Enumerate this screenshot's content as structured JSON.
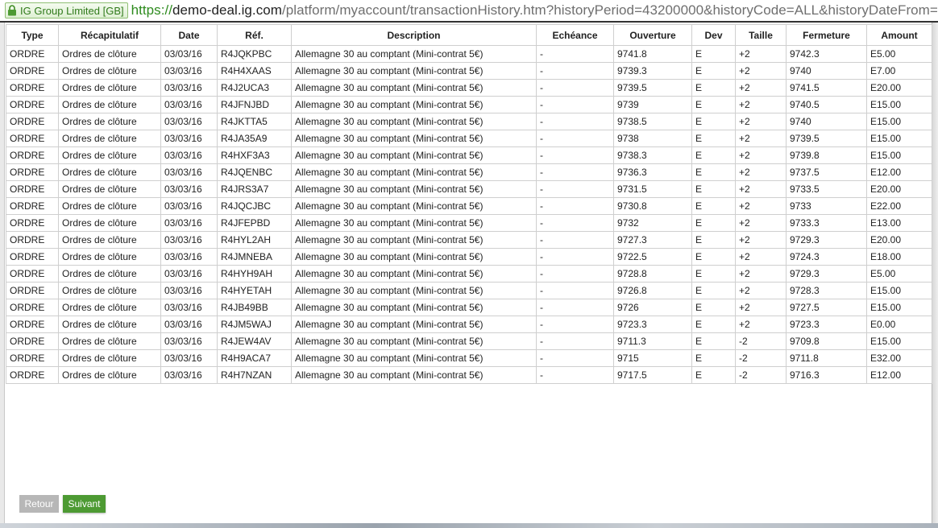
{
  "browser": {
    "cert_label": "IG Group Limited [GB]",
    "url_scheme": "https://",
    "url_host": "demo-deal.ig.com",
    "url_rest": "/platform/myaccount/transactionHistory.htm?historyPeriod=43200000&historyCode=ALL&historyDateFrom=TODA"
  },
  "table": {
    "headers": [
      "Type",
      "Récapitulatif",
      "Date",
      "Réf.",
      "Description",
      "Echéance",
      "Ouverture",
      "Dev",
      "Taille",
      "Fermeture",
      "Amount"
    ],
    "rows": [
      [
        "ORDRE",
        "Ordres de clôture",
        "03/03/16",
        "R4JQKPBC",
        "Allemagne 30 au comptant (Mini-contrat 5€)",
        "-",
        "9741.8",
        "E",
        "+2",
        "9742.3",
        "E5.00"
      ],
      [
        "ORDRE",
        "Ordres de clôture",
        "03/03/16",
        "R4H4XAAS",
        "Allemagne 30 au comptant (Mini-contrat 5€)",
        "-",
        "9739.3",
        "E",
        "+2",
        "9740",
        "E7.00"
      ],
      [
        "ORDRE",
        "Ordres de clôture",
        "03/03/16",
        "R4J2UCA3",
        "Allemagne 30 au comptant (Mini-contrat 5€)",
        "-",
        "9739.5",
        "E",
        "+2",
        "9741.5",
        "E20.00"
      ],
      [
        "ORDRE",
        "Ordres de clôture",
        "03/03/16",
        "R4JFNJBD",
        "Allemagne 30 au comptant (Mini-contrat 5€)",
        "-",
        "9739",
        "E",
        "+2",
        "9740.5",
        "E15.00"
      ],
      [
        "ORDRE",
        "Ordres de clôture",
        "03/03/16",
        "R4JKTTA5",
        "Allemagne 30 au comptant (Mini-contrat 5€)",
        "-",
        "9738.5",
        "E",
        "+2",
        "9740",
        "E15.00"
      ],
      [
        "ORDRE",
        "Ordres de clôture",
        "03/03/16",
        "R4JA35A9",
        "Allemagne 30 au comptant (Mini-contrat 5€)",
        "-",
        "9738",
        "E",
        "+2",
        "9739.5",
        "E15.00"
      ],
      [
        "ORDRE",
        "Ordres de clôture",
        "03/03/16",
        "R4HXF3A3",
        "Allemagne 30 au comptant (Mini-contrat 5€)",
        "-",
        "9738.3",
        "E",
        "+2",
        "9739.8",
        "E15.00"
      ],
      [
        "ORDRE",
        "Ordres de clôture",
        "03/03/16",
        "R4JQENBC",
        "Allemagne 30 au comptant (Mini-contrat 5€)",
        "-",
        "9736.3",
        "E",
        "+2",
        "9737.5",
        "E12.00"
      ],
      [
        "ORDRE",
        "Ordres de clôture",
        "03/03/16",
        "R4JRS3A7",
        "Allemagne 30 au comptant (Mini-contrat 5€)",
        "-",
        "9731.5",
        "E",
        "+2",
        "9733.5",
        "E20.00"
      ],
      [
        "ORDRE",
        "Ordres de clôture",
        "03/03/16",
        "R4JQCJBC",
        "Allemagne 30 au comptant (Mini-contrat 5€)",
        "-",
        "9730.8",
        "E",
        "+2",
        "9733",
        "E22.00"
      ],
      [
        "ORDRE",
        "Ordres de clôture",
        "03/03/16",
        "R4JFEPBD",
        "Allemagne 30 au comptant (Mini-contrat 5€)",
        "-",
        "9732",
        "E",
        "+2",
        "9733.3",
        "E13.00"
      ],
      [
        "ORDRE",
        "Ordres de clôture",
        "03/03/16",
        "R4HYL2AH",
        "Allemagne 30 au comptant (Mini-contrat 5€)",
        "-",
        "9727.3",
        "E",
        "+2",
        "9729.3",
        "E20.00"
      ],
      [
        "ORDRE",
        "Ordres de clôture",
        "03/03/16",
        "R4JMNEBA",
        "Allemagne 30 au comptant (Mini-contrat 5€)",
        "-",
        "9722.5",
        "E",
        "+2",
        "9724.3",
        "E18.00"
      ],
      [
        "ORDRE",
        "Ordres de clôture",
        "03/03/16",
        "R4HYH9AH",
        "Allemagne 30 au comptant (Mini-contrat 5€)",
        "-",
        "9728.8",
        "E",
        "+2",
        "9729.3",
        "E5.00"
      ],
      [
        "ORDRE",
        "Ordres de clôture",
        "03/03/16",
        "R4HYETAH",
        "Allemagne 30 au comptant (Mini-contrat 5€)",
        "-",
        "9726.8",
        "E",
        "+2",
        "9728.3",
        "E15.00"
      ],
      [
        "ORDRE",
        "Ordres de clôture",
        "03/03/16",
        "R4JB49BB",
        "Allemagne 30 au comptant (Mini-contrat 5€)",
        "-",
        "9726",
        "E",
        "+2",
        "9727.5",
        "E15.00"
      ],
      [
        "ORDRE",
        "Ordres de clôture",
        "03/03/16",
        "R4JM5WAJ",
        "Allemagne 30 au comptant (Mini-contrat 5€)",
        "-",
        "9723.3",
        "E",
        "+2",
        "9723.3",
        "E0.00"
      ],
      [
        "ORDRE",
        "Ordres de clôture",
        "03/03/16",
        "R4JEW4AV",
        "Allemagne 30 au comptant (Mini-contrat 5€)",
        "-",
        "9711.3",
        "E",
        "-2",
        "9709.8",
        "E15.00"
      ],
      [
        "ORDRE",
        "Ordres de clôture",
        "03/03/16",
        "R4H9ACA7",
        "Allemagne 30 au comptant (Mini-contrat 5€)",
        "-",
        "9715",
        "E",
        "-2",
        "9711.8",
        "E32.00"
      ],
      [
        "ORDRE",
        "Ordres de clôture",
        "03/03/16",
        "R4H7NZAN",
        "Allemagne 30 au comptant (Mini-contrat 5€)",
        "-",
        "9717.5",
        "E",
        "-2",
        "9716.3",
        "E12.00"
      ]
    ]
  },
  "pagination": {
    "back_label": "Retour",
    "next_label": "Suivant"
  },
  "colors": {
    "next_button": "#4d9a33",
    "back_button": "#b7b7b7",
    "secure_green": "#2e8b1e"
  }
}
